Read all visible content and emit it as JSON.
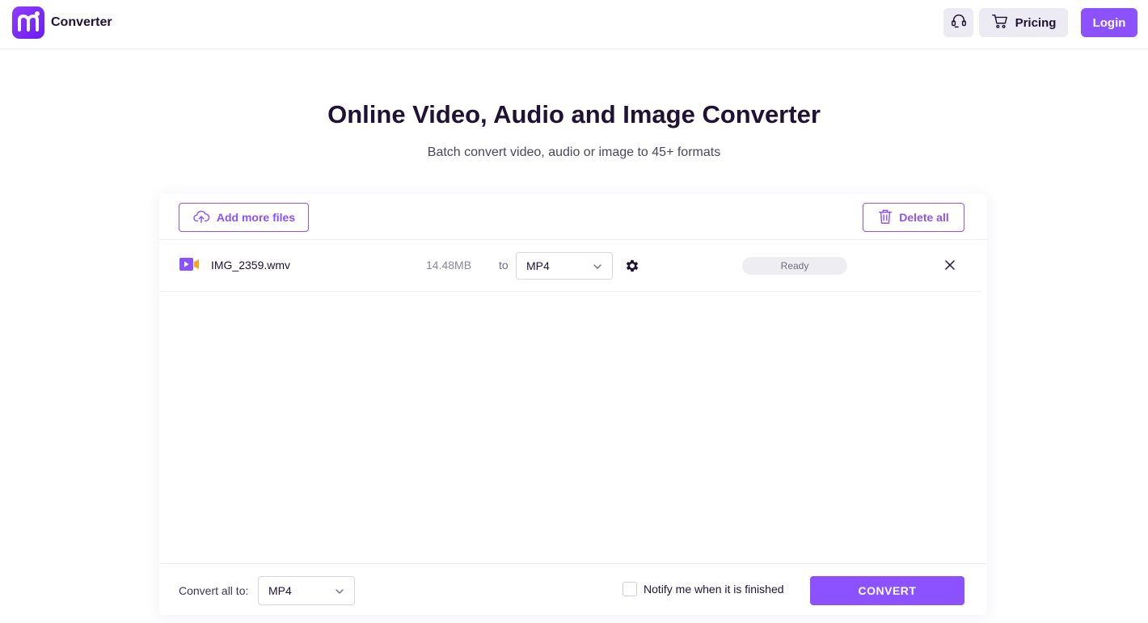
{
  "header": {
    "brand_name": "Converter",
    "pricing_label": "Pricing",
    "login_label": "Login"
  },
  "hero": {
    "title": "Online Video, Audio and Image Converter",
    "subtitle": "Batch convert video, audio or image to 45+ formats"
  },
  "toolbar": {
    "add_label": "Add more files",
    "delete_label": "Delete all"
  },
  "files": [
    {
      "name": "IMG_2359.wmv",
      "size": "14.48MB",
      "to_label": "to",
      "format": "MP4",
      "status": "Ready"
    }
  ],
  "footer": {
    "convert_all_label": "Convert all to:",
    "convert_all_format": "MP4",
    "notify_label": "Notify me when it is finished",
    "convert_label": "CONVERT"
  },
  "colors": {
    "accent": "#8c52ff",
    "text": "#1f1235",
    "icon_video": "#8c52ff",
    "icon_video_secondary": "#f5a623"
  }
}
